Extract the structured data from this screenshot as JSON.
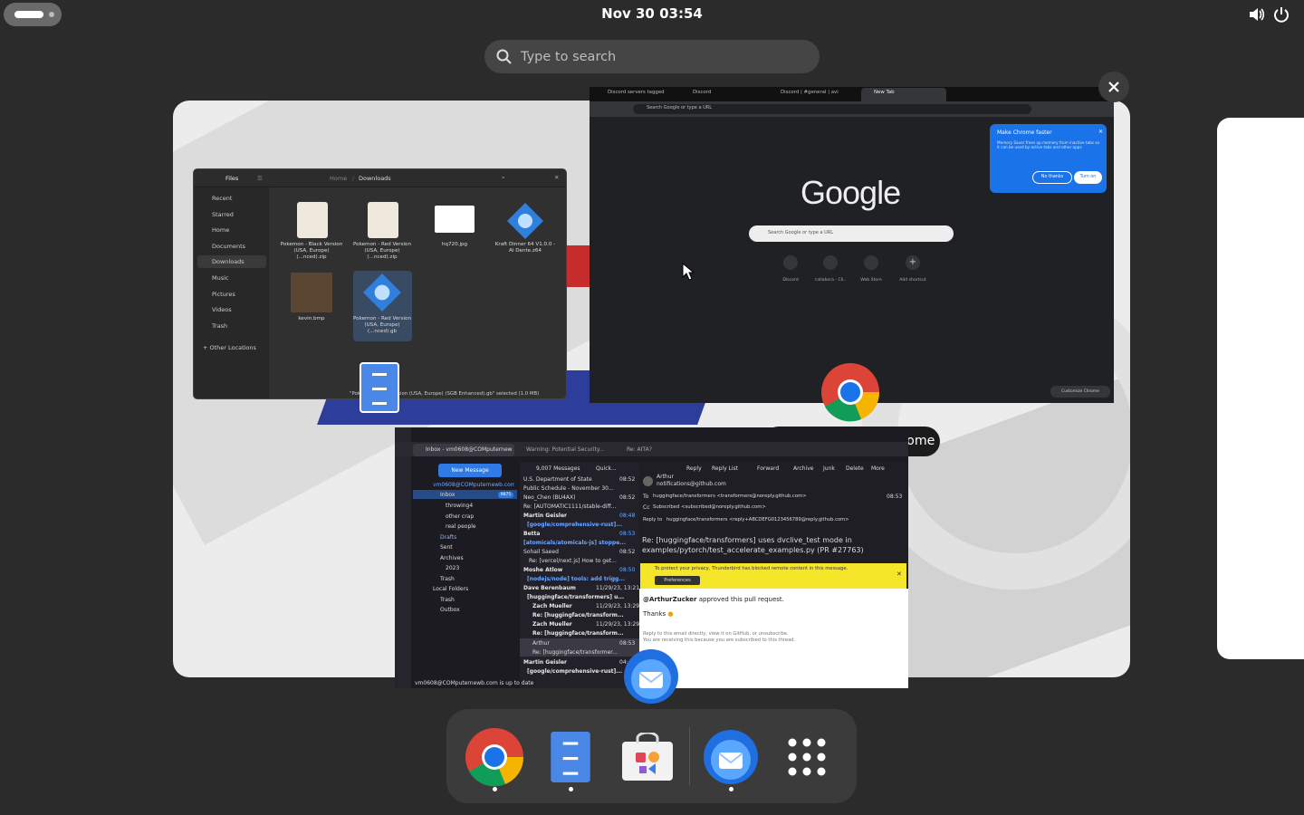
{
  "top_bar": {
    "clock": "Nov 30  03:54",
    "icons": [
      "activities-pill",
      "volume-icon",
      "power-icon"
    ]
  },
  "search": {
    "placeholder": "Type to search"
  },
  "tooltip": "New Tab - Google Chrome",
  "files_window": {
    "title": "Files",
    "path": [
      "Home",
      "Downloads"
    ],
    "sidebar": [
      "Recent",
      "Starred",
      "Home",
      "Documents",
      "Downloads",
      "Music",
      "Pictures",
      "Videos",
      "Trash",
      "+ Other Locations"
    ],
    "files": [
      {
        "name": "Pokemon - Black Version (USA, Europe) (...nced).zip"
      },
      {
        "name": "Pokemon - Red Version (USA, Europe) (...nced).zip"
      },
      {
        "name": "hq720.jpg"
      },
      {
        "name": "Kraft Dinner 64 V1.0.0 - Al Dente.z64"
      },
      {
        "name": "kevin.bmp"
      },
      {
        "name": "Pokemon - Red Version (USA, Europe) (...nced).gb"
      }
    ],
    "status": "\"Pokemon - Red Version (USA, Europe) (SGB Enhanced).gb\" selected (1.0 MB)"
  },
  "chrome_window": {
    "tabs": [
      "Discord servers tagged",
      "Discord",
      "Discord | #general | avi",
      "New Tab"
    ],
    "address": "Search Google or type a URL",
    "logo": "Google",
    "search_placeholder": "Search Google or type a URL",
    "shortcuts": [
      "Discord",
      "collabora - Cli..",
      "Web Store",
      "Add shortcut"
    ],
    "popup": {
      "title": "Make Chrome faster",
      "body": "Memory Saver frees up memory from inactive tabs so it can be used by active tabs and other apps",
      "no": "No thanks",
      "yes": "Turn on"
    },
    "customize": "Customize Chrome"
  },
  "thunderbird_window": {
    "tabs": [
      "Inbox - vm0608@COMputernewb...",
      "Warning: Potential Security...",
      "Re: AITA?"
    ],
    "new_message": "New Message",
    "account": "vm0608@COMputernewb.com",
    "folders": [
      "Inbox",
      "throwing4",
      "other crap",
      "real people",
      "Drafts",
      "Sent",
      "Archives",
      "2023",
      "Trash",
      "Local Folders",
      "Trash",
      "Outbox"
    ],
    "inbox_badge": "9875",
    "count": "9,007 Messages",
    "quick_filter": "Quick...",
    "messages": [
      {
        "from": "U.S. Department of State",
        "time": "08:52"
      },
      {
        "from": "Public Schedule - November 30...",
        "time": ""
      },
      {
        "from": "Neo_Chen (BU4AX)",
        "time": "08:52"
      },
      {
        "from": "Re: [AUTOMATIC1111/stable-diff...",
        "time": ""
      },
      {
        "from": "Martin Geisler",
        "time": "08:48"
      },
      {
        "from": "[google/comprehensive-rust]...",
        "time": ""
      },
      {
        "from": "Betta",
        "time": "08:53"
      },
      {
        "from": "[atomicals/atomicals-js] stoppe...",
        "time": ""
      },
      {
        "from": "Sohail Saeed",
        "time": "08:52"
      },
      {
        "from": "Re: [vercel/next.js] How to get...",
        "time": ""
      },
      {
        "from": "Moshe Atlow",
        "time": "08:50"
      },
      {
        "from": "[nodejs/node] tools: add trigg...",
        "time": ""
      },
      {
        "from": "Dave Berenbaum",
        "time": "11/29/23, 13:21"
      },
      {
        "from": "[huggingface/transformers] u...",
        "time": ""
      },
      {
        "from": "Zach Mueller",
        "time": "11/29/23, 13:29"
      },
      {
        "from": "Re: [huggingface/transform...",
        "time": ""
      },
      {
        "from": "Zach Mueller",
        "time": "11/29/23, 13:29"
      },
      {
        "from": "Re: [huggingface/transform...",
        "time": ""
      },
      {
        "from": "Arthur",
        "time": "08:53"
      },
      {
        "from": "Re: [huggingface/transformer...",
        "time": ""
      },
      {
        "from": "Martin Geisler",
        "time": "04:"
      },
      {
        "from": "[google/comprehensive-rust]...",
        "time": ""
      }
    ],
    "actions": [
      "Reply",
      "Reply List",
      "Forward",
      "Archive",
      "Junk",
      "Delete",
      "More"
    ],
    "reader": {
      "from": "Arthur",
      "from_email": "notifications@github.com",
      "to": "huggingface/transformers <transformers@noreply.github.com>",
      "time": "08:53",
      "cc": "Subscribed <subscribed@noreply.github.com>",
      "reply_to": "huggingface/transformers <reply+ABCDEFG0123456789@reply.github.com>",
      "subject": "Re: [huggingface/transformers] uses dvclive_test mode in examples/pytorch/test_accelerate_examples.py (PR #27763)",
      "warning": "To protect your privacy, Thunderbird has blocked remote content in this message.",
      "preferences": "Preferences",
      "body_user": "@ArthurZucker",
      "body_text": " approved this pull request.",
      "thanks": "Thanks",
      "footer1": "Reply to this email directly, view it on GitHub, or unsubscribe.",
      "footer2": "You are receiving this because you are subscribed to this thread."
    },
    "status": "vm0608@COMputernewb.com is up to date"
  },
  "dock": [
    "Google Chrome",
    "Files",
    "Software",
    "Thunderbird",
    "Show Apps"
  ]
}
